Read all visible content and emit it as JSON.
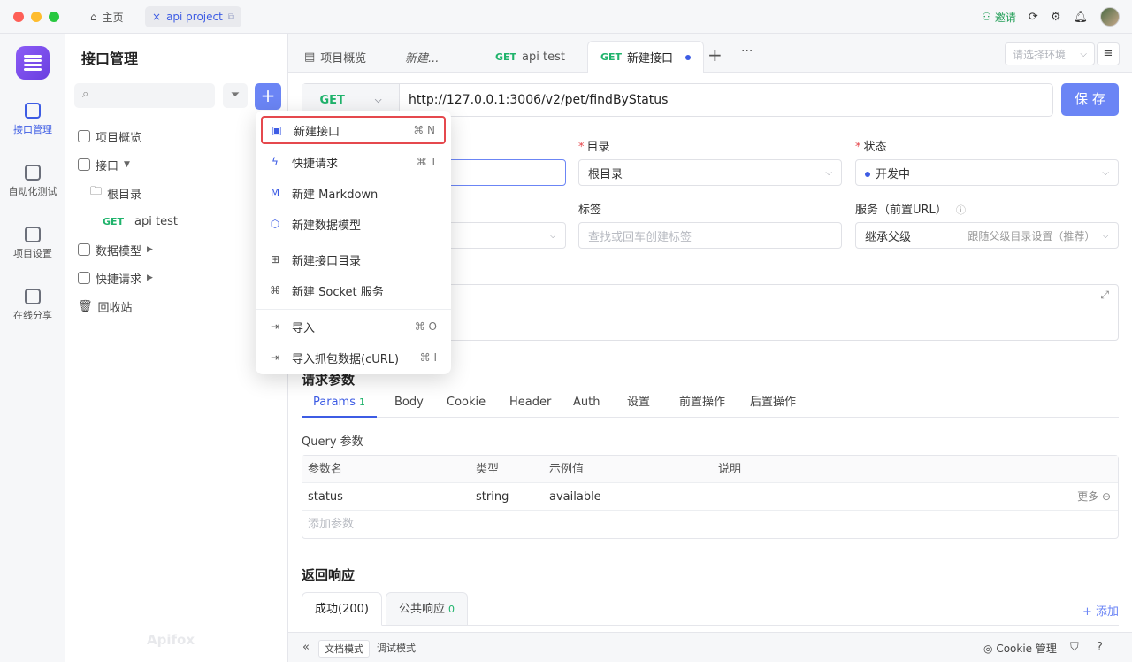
{
  "window": {
    "home_tab": "主页",
    "project_tab": "api project",
    "invite": "邀请"
  },
  "rail": [
    {
      "label": "接口管理"
    },
    {
      "label": "自动化测试"
    },
    {
      "label": "项目设置"
    },
    {
      "label": "在线分享"
    }
  ],
  "sidebar": {
    "title": "接口管理",
    "tree": {
      "overview": "项目概览",
      "api": "接口",
      "root": "根目录",
      "method": "GET",
      "api_test": "api test",
      "models": "数据模型",
      "quick": "快捷请求",
      "trash": "回收站"
    },
    "watermark": "Apifox"
  },
  "tabs": {
    "overview": "项目概览",
    "new": "新建...",
    "get1_method": "GET",
    "get1_name": "api test",
    "get2_method": "GET",
    "get2_name": "新建接口",
    "env_placeholder": "请选择环境"
  },
  "request": {
    "method": "GET",
    "url": "http://127.0.0.1:3006/v2/pet/findByStatus",
    "save": "保 存"
  },
  "form": {
    "dir_label": "目录",
    "dir_value": "根目录",
    "status_label": "状态",
    "status_value": "开发中",
    "tags_label": "标签",
    "tags_placeholder": "查找或回车创建标签",
    "service_label": "服务（前置URL）",
    "service_value": "继承父级",
    "service_hint": "跟随父级目录设置（推荐）"
  },
  "params": {
    "section": "请求参数",
    "tabs": [
      "Params",
      "Body",
      "Cookie",
      "Header",
      "Auth",
      "设置",
      "前置操作",
      "后置操作"
    ],
    "params_count": "1",
    "query_label": "Query 参数",
    "headers": [
      "参数名",
      "类型",
      "示例值",
      "说明"
    ],
    "row": {
      "name": "status",
      "type": "string",
      "example": "available",
      "more": "更多"
    },
    "add_placeholder": "添加参数"
  },
  "response": {
    "section": "返回响应",
    "tab1": "成功(200)",
    "tab2": "公共响应",
    "tab2_count": "0",
    "add": "+ 添加"
  },
  "bottom": {
    "doc_mode": "文档模式",
    "debug_mode": "调试模式",
    "cookie": "Cookie 管理"
  },
  "dropdown": {
    "items": [
      {
        "label": "新建接口",
        "shortcut": "⌘ N",
        "icon": "api-icon"
      },
      {
        "label": "快捷请求",
        "shortcut": "⌘ T",
        "icon": "lightning-icon"
      },
      {
        "label": "新建 Markdown",
        "shortcut": "",
        "icon": "markdown-icon"
      },
      {
        "label": "新建数据模型",
        "shortcut": "",
        "icon": "cube-icon"
      },
      {
        "label": "新建接口目录",
        "shortcut": "",
        "icon": "folder-plus-icon"
      },
      {
        "label": "新建 Socket 服务",
        "shortcut": "",
        "icon": "socket-icon"
      },
      {
        "label": "导入",
        "shortcut": "⌘ O",
        "icon": "import-icon"
      },
      {
        "label": "导入抓包数据(cURL)",
        "shortcut": "⌘ I",
        "icon": "import-curl-icon"
      }
    ]
  },
  "colors": {
    "accent": "#3d5ce4",
    "primary_button": "#6b85f5",
    "get_method": "#1fb36b",
    "highlight": "#e5484d"
  }
}
